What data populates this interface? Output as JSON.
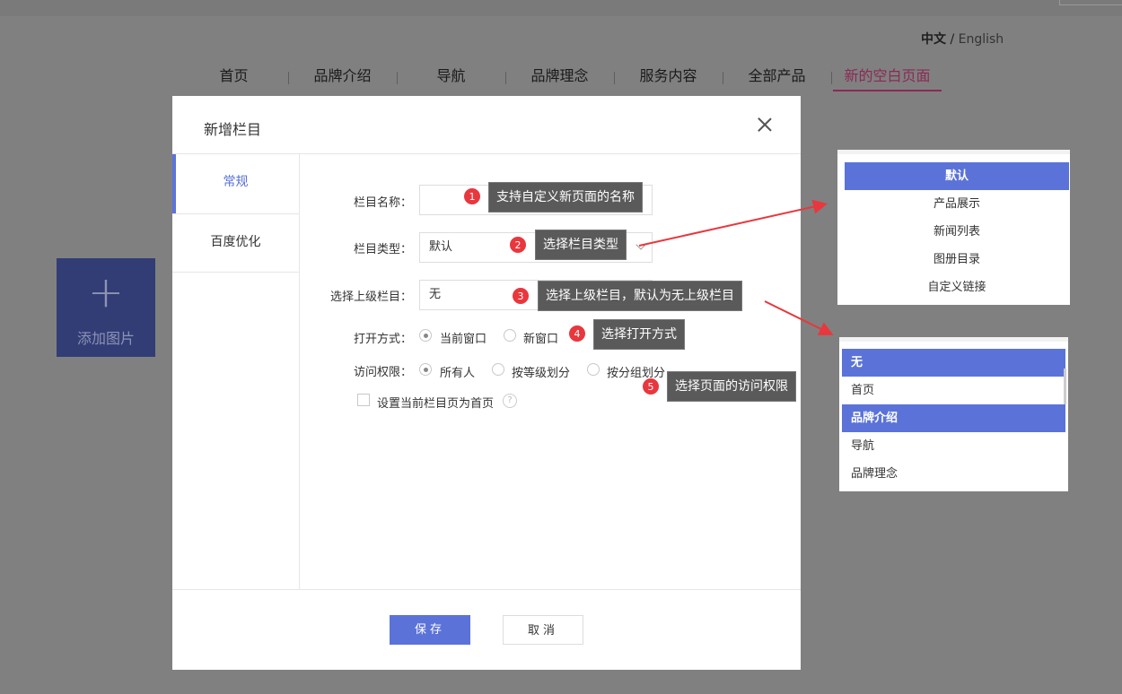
{
  "site": {
    "lang_cn": "中文",
    "lang_sep": " / ",
    "lang_en": "English",
    "nav": [
      "首页",
      "品牌介绍",
      "导航",
      "品牌理念",
      "服务内容",
      "全部产品",
      "新的空白页面"
    ],
    "add_image": "添加图片"
  },
  "modal": {
    "title": "新增栏目",
    "tabs": [
      "常规",
      "百度优化"
    ],
    "fields": {
      "name_label": "栏目名称：",
      "name_value": "",
      "type_label": "栏目类型：",
      "type_value": "默认",
      "parent_label": "选择上级栏目：",
      "parent_value": "无",
      "open_label": "打开方式：",
      "open_options": [
        "当前窗口",
        "新窗口"
      ],
      "access_label": "访问权限：",
      "access_options": [
        "所有人",
        "按等级划分",
        "按分组划分"
      ],
      "homepage_label": "设置当前栏目页为首页",
      "help": "?"
    },
    "save": "保存",
    "cancel": "取消"
  },
  "annotations": [
    {
      "num": "1",
      "text": "支持自定义新页面的名称"
    },
    {
      "num": "2",
      "text": "选择栏目类型"
    },
    {
      "num": "3",
      "text": "选择上级栏目，默认为无上级栏目"
    },
    {
      "num": "4",
      "text": "选择打开方式"
    },
    {
      "num": "5",
      "text": "选择页面的访问权限"
    }
  ],
  "type_dropdown": [
    "默认",
    "产品展示",
    "新闻列表",
    "图册目录",
    "自定义链接"
  ],
  "parent_dropdown": [
    "无",
    "首页",
    "品牌介绍",
    "导航",
    "品牌理念"
  ],
  "colors": {
    "accent": "#5b73d8",
    "badge": "#e8373d",
    "tip_bg": "#5a5a5a",
    "arrow": "#e8373d"
  }
}
